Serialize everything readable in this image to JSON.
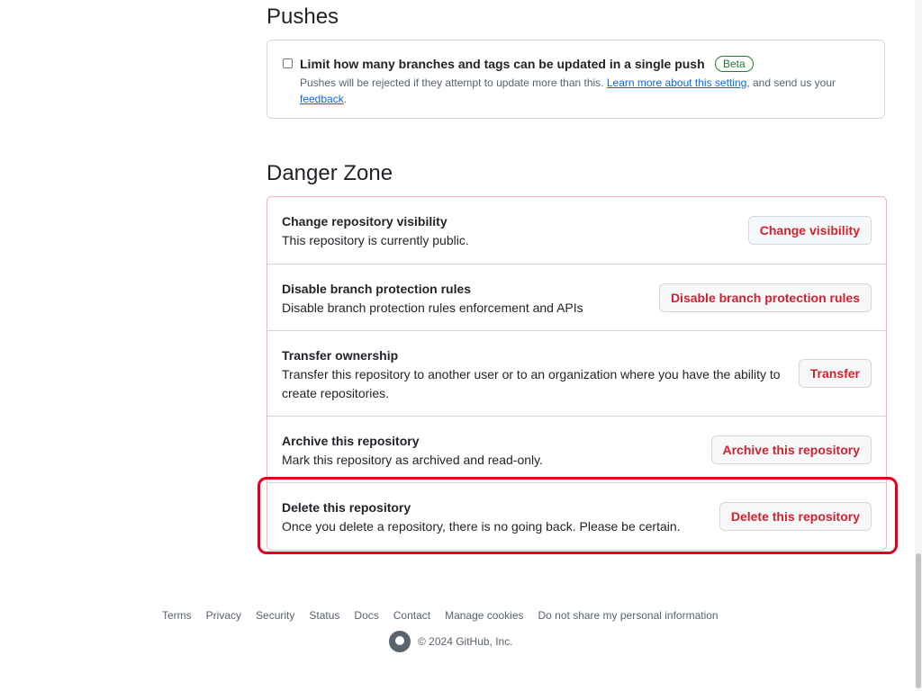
{
  "pushes": {
    "title": "Pushes",
    "limit_label": "Limit how many branches and tags can be updated in a single push",
    "badge": "Beta",
    "desc_prefix": "Pushes will be rejected if they attempt to update more than this. ",
    "learn_more": "Learn more about this setting",
    "desc_mid": ", and send us your ",
    "feedback": "feedback",
    "desc_suffix": "."
  },
  "danger_zone": {
    "title": "Danger Zone",
    "items": [
      {
        "title": "Change repository visibility",
        "desc": "This repository is currently public.",
        "button": "Change visibility"
      },
      {
        "title": "Disable branch protection rules",
        "desc": "Disable branch protection rules enforcement and APIs",
        "button": "Disable branch protection rules"
      },
      {
        "title": "Transfer ownership",
        "desc": "Transfer this repository to another user or to an organization where you have the ability to create repositories.",
        "button": "Transfer"
      },
      {
        "title": "Archive this repository",
        "desc": "Mark this repository as archived and read-only.",
        "button": "Archive this repository"
      },
      {
        "title": "Delete this repository",
        "desc": "Once you delete a repository, there is no going back. Please be certain.",
        "button": "Delete this repository"
      }
    ]
  },
  "footer": {
    "links": [
      "Terms",
      "Privacy",
      "Security",
      "Status",
      "Docs",
      "Contact",
      "Manage cookies",
      "Do not share my personal information"
    ],
    "copyright": "© 2024 GitHub, Inc.",
    "logo_icon": "github-logo-icon"
  },
  "colors": {
    "danger": "#cf222e",
    "highlight": "#e0001b",
    "link": "#0969da",
    "beta": "#1a7f37"
  }
}
